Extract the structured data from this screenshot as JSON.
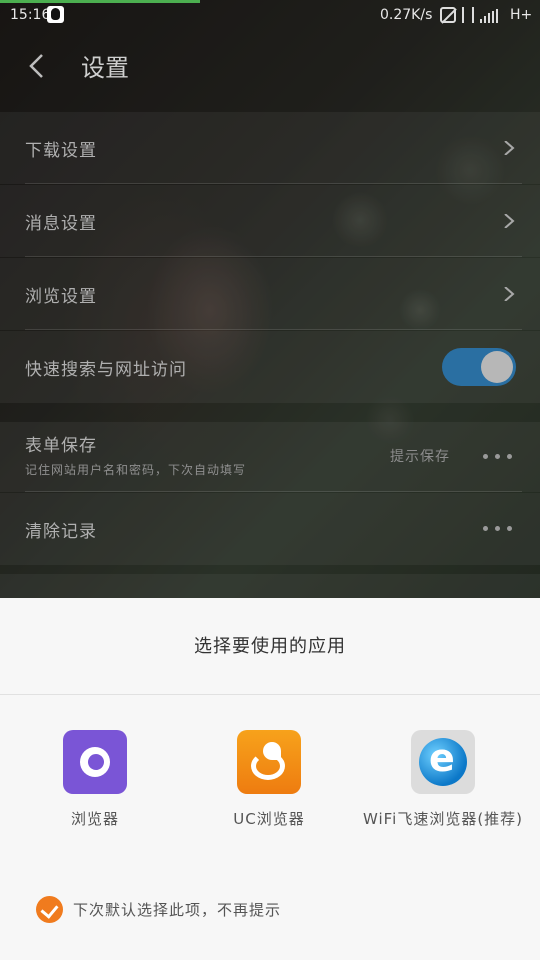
{
  "status_bar": {
    "time": "15:16",
    "speed": "0.27K/s",
    "network": "H+",
    "page_load_progress": 0.37
  },
  "header": {
    "title": "设置"
  },
  "settings": {
    "items": [
      {
        "label": "下载设置"
      },
      {
        "label": "消息设置"
      },
      {
        "label": "浏览设置"
      },
      {
        "label": "快速搜索与网址访问",
        "toggle_on": true
      },
      {
        "label": "表单保存",
        "description": "记住网站用户名和密码，下次自动填写",
        "value": "提示保存"
      },
      {
        "label": "清除记录"
      }
    ]
  },
  "chooser": {
    "title": "选择要使用的应用",
    "apps": [
      {
        "label": "浏览器",
        "icon": "mi-browser-icon"
      },
      {
        "label": "UC浏览器",
        "icon": "uc-browser-icon"
      },
      {
        "label": "WiFi飞速浏览器(推荐)",
        "icon": "wifi-browser-icon"
      }
    ],
    "default_option": {
      "label": "下次默认选择此项，不再提示",
      "checked": true
    }
  },
  "colors": {
    "accent": "#f07b1e",
    "toggle_on": "#2a6fa2",
    "progress": "#4caf50"
  }
}
